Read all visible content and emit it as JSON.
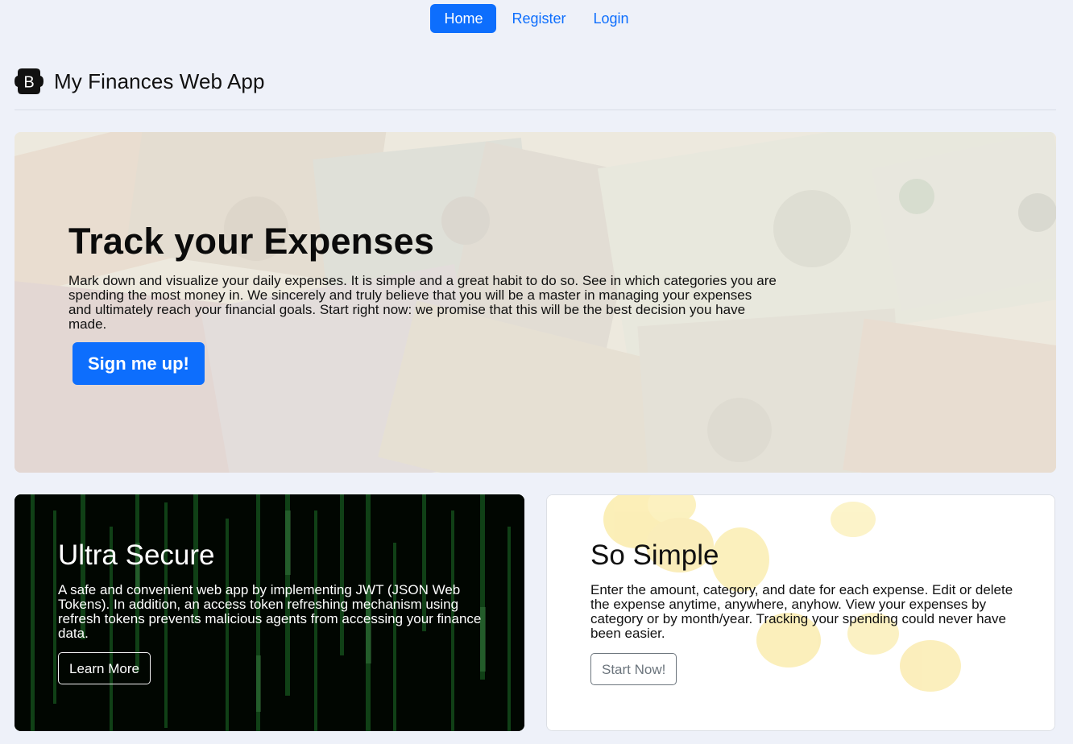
{
  "nav": {
    "items": [
      {
        "label": "Home",
        "active": true
      },
      {
        "label": "Register",
        "active": false
      },
      {
        "label": "Login",
        "active": false
      }
    ]
  },
  "brand": {
    "logo_letter": "B",
    "title": "My Finances Web App"
  },
  "hero": {
    "title": "Track your Expenses",
    "text": "Mark down and visualize your daily expenses. It is simple and a great habit to do so. See in which categories you are spending the most money in. We sincerely and truly believe that you will be a master in managing your expenses and ultimately reach your financial goals. Start right now: we promise that this will be the best decision you have made.",
    "button_label": "Sign me up!"
  },
  "cards": {
    "secure": {
      "title": "Ultra Secure",
      "text": "A safe and convenient web app by implementing JWT (JSON Web Tokens). In addition, an access token refreshing mechanism using refresh tokens prevents malicious agents from accessing your finance data.",
      "button_label": "Learn More"
    },
    "simple": {
      "title": "So Simple",
      "text": "Enter the amount, category, and date for each expense. Edit or delete the expense anytime, anywhere, anyhow. View your expenses by category or by month/year. Tracking your spending could never have been easier.",
      "button_label": "Start Now!"
    }
  },
  "colors": {
    "primary": "#0d6efd",
    "page_background": "#eef1f9",
    "secondary": "#6c757d"
  },
  "icons": {
    "brand_logo": "bootstrap-logo-icon"
  }
}
